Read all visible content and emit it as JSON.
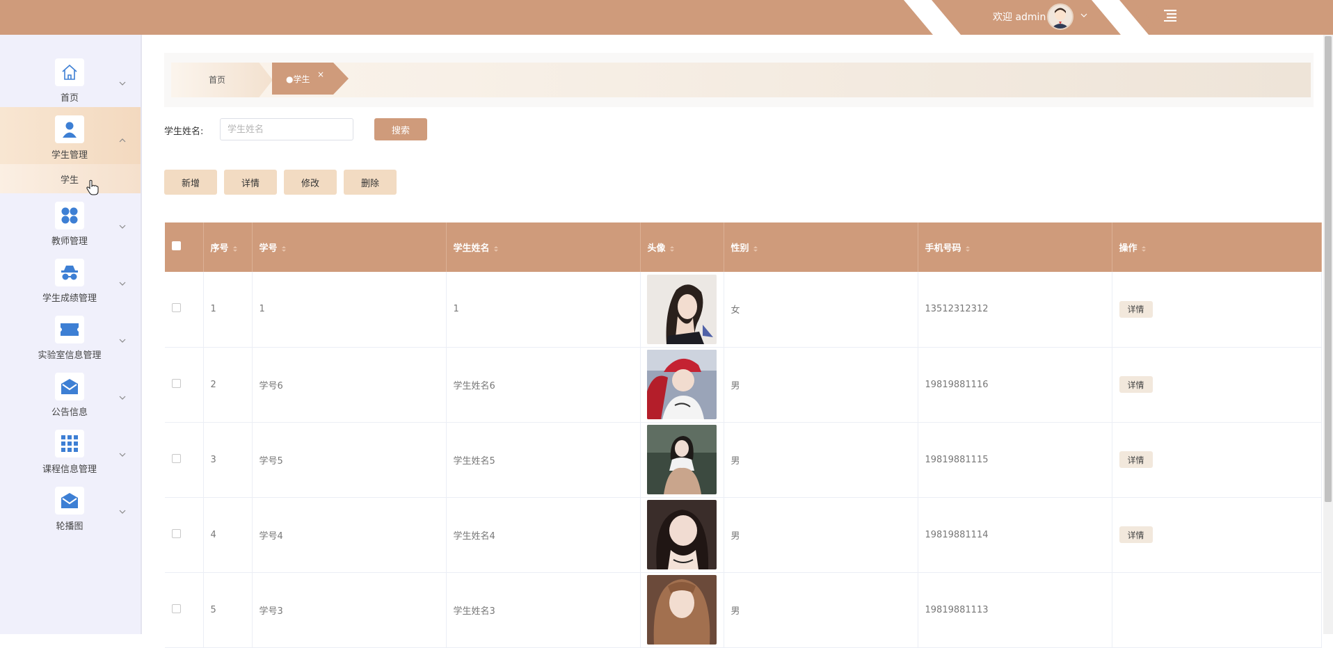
{
  "header": {
    "welcome": "欢迎 admin",
    "colors": {
      "bar": "#cf9b7b"
    }
  },
  "sidebar": {
    "items": [
      {
        "label": "首页",
        "icon": "home-icon"
      },
      {
        "label": "学生管理",
        "icon": "user-icon",
        "expanded": true,
        "children": [
          "学生"
        ]
      },
      {
        "label": "教师管理",
        "icon": "grid-dots-icon"
      },
      {
        "label": "学生成绩管理",
        "icon": "spy-icon"
      },
      {
        "label": "实验室信息管理",
        "icon": "ticket-icon"
      },
      {
        "label": "公告信息",
        "icon": "mail-icon"
      },
      {
        "label": "课程信息管理",
        "icon": "apps-icon"
      },
      {
        "label": "轮播图",
        "icon": "mail-icon"
      }
    ]
  },
  "breadcrumb": {
    "home": "首页",
    "active": "学生",
    "close": "×"
  },
  "search": {
    "label": "学生姓名:",
    "placeholder": "学生姓名",
    "button": "搜索"
  },
  "actions": {
    "add": "新增",
    "detail": "详情",
    "edit": "修改",
    "delete": "删除"
  },
  "table": {
    "columns": [
      "序号",
      "学号",
      "学生姓名",
      "头像",
      "性别",
      "手机号码",
      "操作"
    ],
    "rows": [
      {
        "index": "1",
        "student_id": "1",
        "name": "1",
        "gender": "女",
        "phone": "13512312312",
        "action": "详情"
      },
      {
        "index": "2",
        "student_id": "学号6",
        "name": "学生姓名6",
        "gender": "男",
        "phone": "19819881116",
        "action": "详情"
      },
      {
        "index": "3",
        "student_id": "学号5",
        "name": "学生姓名5",
        "gender": "男",
        "phone": "19819881115",
        "action": "详情"
      },
      {
        "index": "4",
        "student_id": "学号4",
        "name": "学生姓名4",
        "gender": "男",
        "phone": "19819881114",
        "action": "详情"
      },
      {
        "index": "5",
        "student_id": "学号3",
        "name": "学生姓名3",
        "gender": "男",
        "phone": "19819881113",
        "action": ""
      }
    ]
  }
}
